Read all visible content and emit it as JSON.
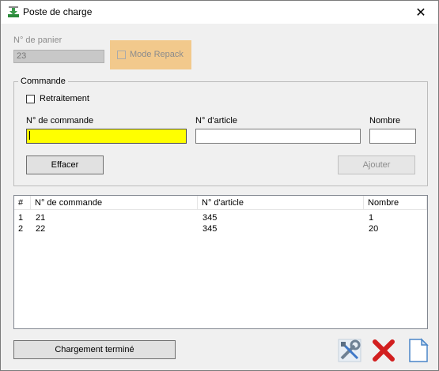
{
  "window": {
    "title": "Poste de charge"
  },
  "panier": {
    "label": "N° de panier",
    "value": "23"
  },
  "repack": {
    "label": "Mode Repack"
  },
  "commande": {
    "group_title": "Commande",
    "retraitement_label": "Retraitement",
    "numero_commande_label": "N° de commande",
    "numero_article_label": "N° d'article",
    "nombre_label": "Nombre",
    "numero_commande_value": "",
    "numero_article_value": "",
    "nombre_value": "",
    "effacer_label": "Effacer",
    "ajouter_label": "Ajouter"
  },
  "list": {
    "columns": [
      "#",
      "N° de commande",
      "N° d'article",
      "Nombre"
    ],
    "rows": [
      [
        "1",
        "21",
        "345",
        "1"
      ],
      [
        "2",
        "22",
        "345",
        "20"
      ]
    ]
  },
  "footer": {
    "chargement_label": "Chargement terminé"
  },
  "icons": {
    "tools": "tools-icon",
    "cancel": "cancel-icon",
    "document": "document-icon"
  },
  "colors": {
    "active_field": "#ffff00",
    "repack_highlight": "#f2c98c"
  }
}
